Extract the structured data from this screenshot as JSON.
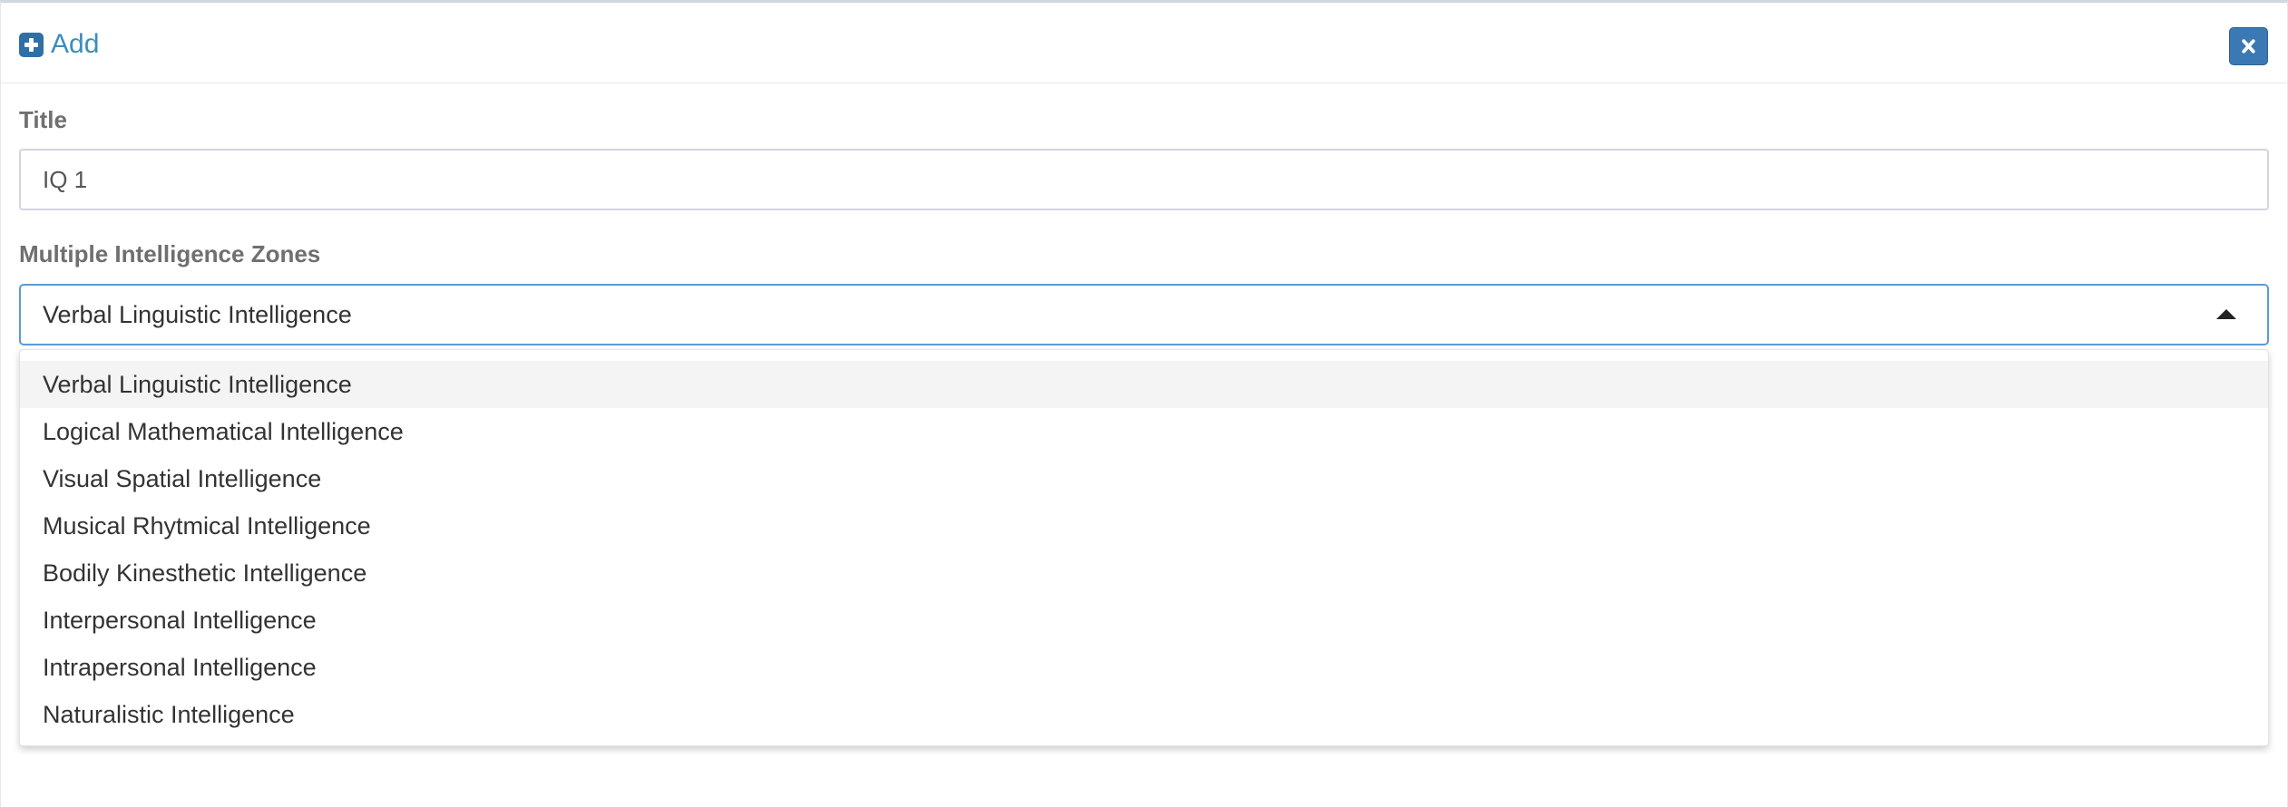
{
  "header": {
    "add_label": "Add",
    "add_icon": "plus-square-icon",
    "close_icon": "close-icon",
    "accent_color": "#3c8dbc"
  },
  "form": {
    "title_label": "Title",
    "title_value": "IQ 1",
    "zones_label": "Multiple Intelligence Zones",
    "zones_selected": "Verbal Linguistic Intelligence",
    "zones_options": [
      "Verbal Linguistic Intelligence",
      "Logical Mathematical Intelligence",
      "Visual Spatial Intelligence",
      "Musical Rhytmical Intelligence",
      "Bodily Kinesthetic Intelligence",
      "Interpersonal Intelligence",
      "Intrapersonal Intelligence",
      "Naturalistic Intelligence"
    ]
  }
}
